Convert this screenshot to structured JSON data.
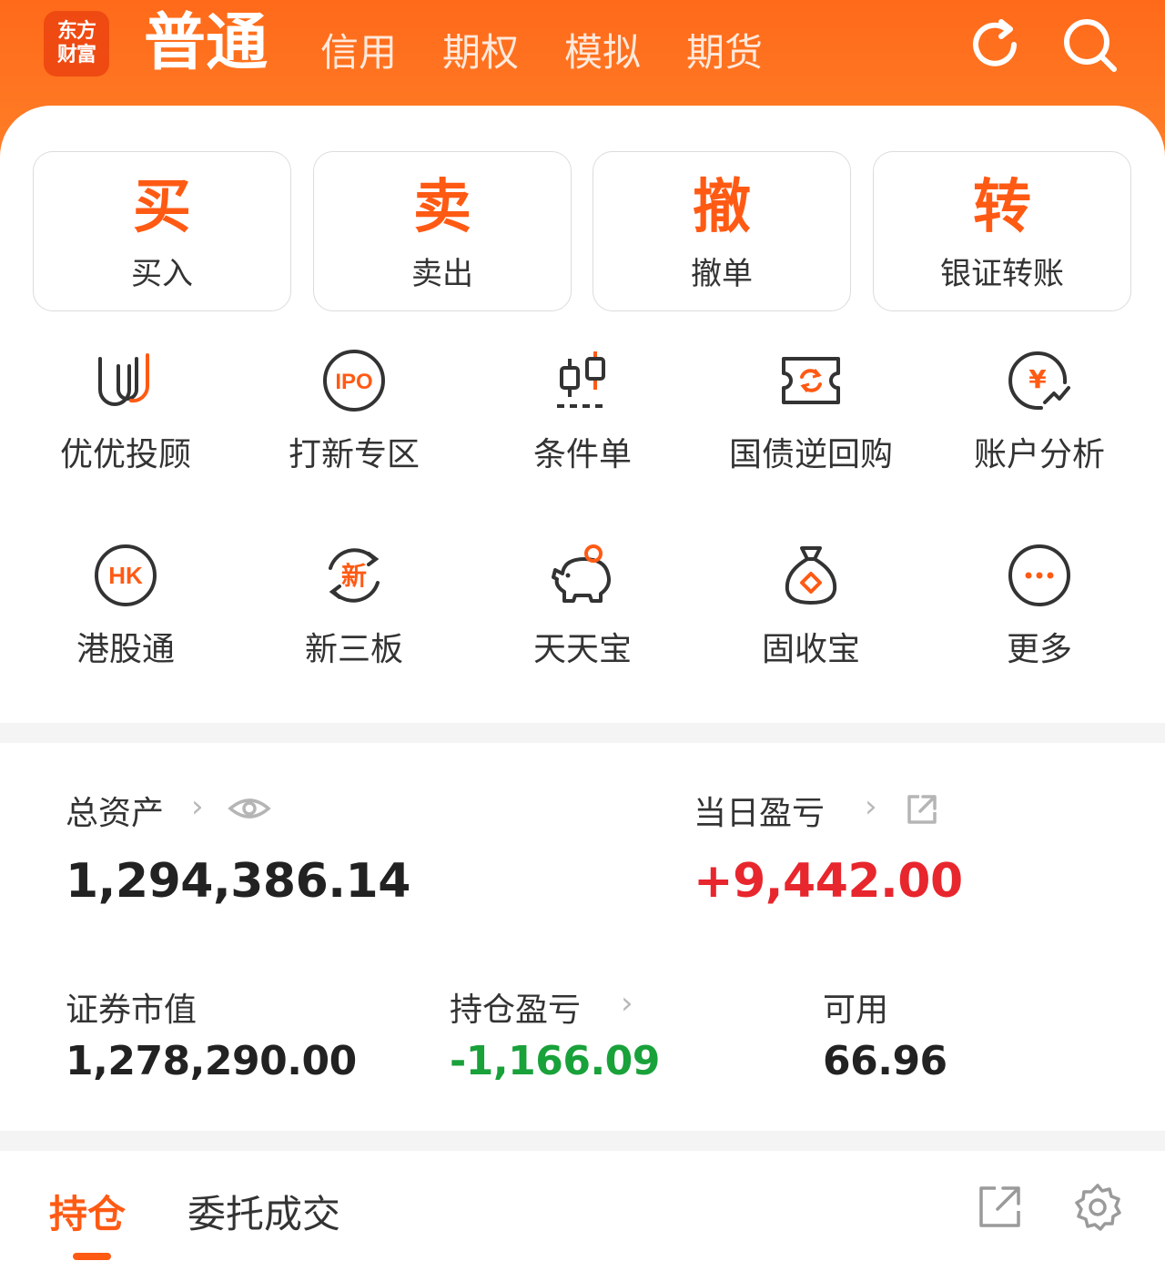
{
  "header": {
    "logo_line1": "东方",
    "logo_line2": "财富",
    "active_tab": "普通",
    "tabs": [
      "信用",
      "期权",
      "模拟",
      "期货"
    ]
  },
  "actions": [
    {
      "char": "买",
      "label": "买入"
    },
    {
      "char": "卖",
      "label": "卖出"
    },
    {
      "char": "撤",
      "label": "撤单"
    },
    {
      "char": "转",
      "label": "银证转账"
    }
  ],
  "grid": [
    {
      "label": "优优投顾",
      "icon": "uu-advisor-icon"
    },
    {
      "label": "打新专区",
      "icon": "ipo-icon",
      "icon_text": "IPO"
    },
    {
      "label": "条件单",
      "icon": "candlestick-icon"
    },
    {
      "label": "国债逆回购",
      "icon": "ticket-refresh-icon"
    },
    {
      "label": "账户分析",
      "icon": "yen-chat-icon",
      "icon_text": "¥"
    },
    {
      "label": "港股通",
      "icon": "hk-icon",
      "icon_text": "HK"
    },
    {
      "label": "新三板",
      "icon": "new-board-icon",
      "icon_text": "新"
    },
    {
      "label": "天天宝",
      "icon": "piggy-bank-icon"
    },
    {
      "label": "固收宝",
      "icon": "money-bag-icon"
    },
    {
      "label": "更多",
      "icon": "more-icon"
    }
  ],
  "assets": {
    "total_label": "总资产",
    "total_value": "1,294,386.14",
    "daily_pl_label": "当日盈亏",
    "daily_pl_value": "+9,442.00",
    "securities_label": "证券市值",
    "securities_value": "1,278,290.00",
    "position_pl_label": "持仓盈亏",
    "position_pl_value": "-1,166.09",
    "available_label": "可用",
    "available_value": "66.96"
  },
  "bottom_tabs": {
    "active": "持仓",
    "other": "委托成交"
  },
  "colors": {
    "brand": "#ff6a1a",
    "accent": "#ff5a14",
    "profit": "#e8262d",
    "loss": "#19a13a"
  }
}
